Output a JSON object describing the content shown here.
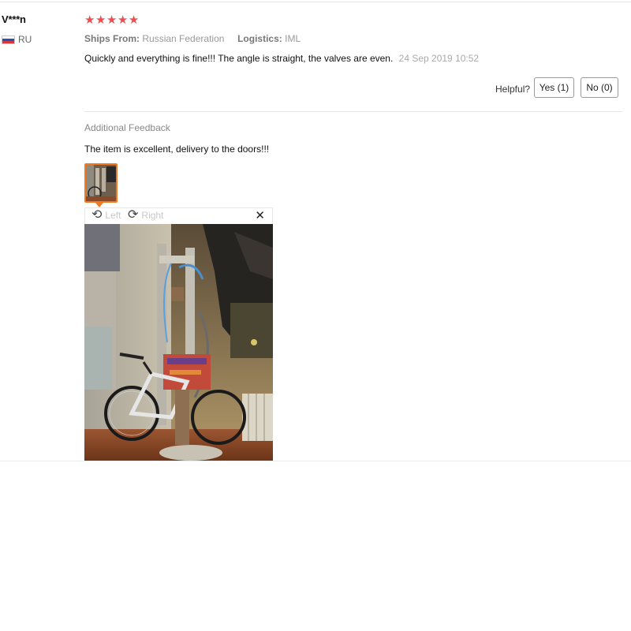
{
  "reviewer": {
    "name": "V***n",
    "country_code": "RU",
    "flag_colors": [
      "#ffffff",
      "#2b4fb5",
      "#d83a3a"
    ]
  },
  "review": {
    "rating": 5,
    "max_rating": 5,
    "star_color": "#ef4e4e",
    "ships_from_label": "Ships From:",
    "ships_from_value": "Russian Federation",
    "logistics_label": "Logistics:",
    "logistics_value": "IML",
    "text": "Quickly and everything is fine!!! The angle is straight, the valves are even.",
    "date": "24 Sep 2019 10:52"
  },
  "helpful": {
    "label": "Helpful?",
    "yes_label": "Yes (1)",
    "no_label": "No (0)"
  },
  "additional_feedback": {
    "heading": "Additional Feedback",
    "text": "The item is excellent, delivery to the doors!!!"
  },
  "image_viewer": {
    "rotate_left_label": "Left",
    "rotate_right_label": "Right",
    "close_icon": "close-icon",
    "thumbnail_border_color": "#f07a22"
  }
}
